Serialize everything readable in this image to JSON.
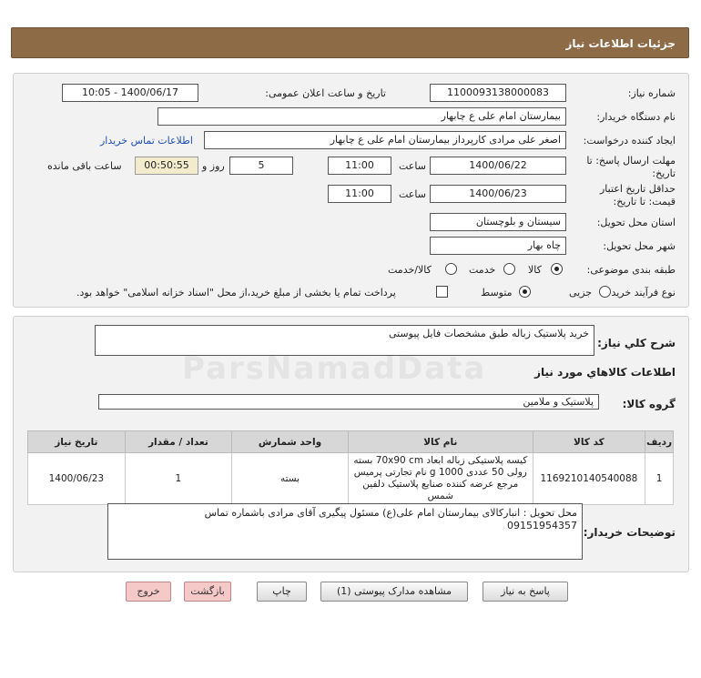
{
  "header": {
    "title": "جزئیات اطلاعات نیاز"
  },
  "form": {
    "need_number_label": "شماره نیاز:",
    "need_number": "1100093138000083",
    "announce_label": "تاریخ و ساعت اعلان عمومی:",
    "announce_value": "1400/06/17 - 10:05",
    "buyer_org_label": "نام دستگاه خریدار:",
    "buyer_org": "بیمارستان امام علی  ع  چابهار",
    "requester_label": "ایجاد کننده درخواست:",
    "requester": "اصغر علی مرادی کارپرداز بیمارستان امام علی  ع  چابهار",
    "buyer_contact_link": "اطلاعات تماس خریدار",
    "deadline_label": "مهلت ارسال پاسخ: تا",
    "deadline_label2": "تاریخ:",
    "deadline_date": "1400/06/22",
    "time_label": "ساعت",
    "deadline_time": "11:00",
    "days_value": "5",
    "days_label": "روز و",
    "remaining_time": "00:50:55",
    "remaining_label": "ساعت باقی مانده",
    "validity_label": "حداقل تاریخ اعتبار",
    "validity_label2": "قیمت: تا تاریخ:",
    "validity_date": "1400/06/23",
    "validity_time": "11:00",
    "province_label": "استان محل تحویل:",
    "province": "سیستان و بلوچستان",
    "city_label": "شهر محل تحویل:",
    "city": "چاه بهار",
    "category_label": "طبقه بندی موضوعی:",
    "category_options": [
      "کالا",
      "خدمت",
      "کالا/خدمت"
    ],
    "purchase_type_label": "نوع فرآیند خرید :",
    "purchase_options": [
      "جزیی",
      "متوسط"
    ],
    "payment_note": "پرداخت تمام یا بخشی از مبلغ خرید،از محل \"اسناد خزانه اسلامی\" خواهد بود."
  },
  "summary": {
    "need_desc_label": "شرح کلي نياز:",
    "need_desc": "خرید پلاستیک زباله طبق مشخصات فایل پیوستی",
    "goods_info_title": "اطلاعات کالاهاي مورد نياز",
    "goods_group_label": "گروه کالا:",
    "goods_group": "پلاستیک و ملامین",
    "watermark": "ParsNamadData"
  },
  "table": {
    "headers": [
      "ردیف",
      "کد کالا",
      "نام کالا",
      "واحد شمارش",
      "تعداد / مقدار",
      "تاریخ نیاز"
    ],
    "rows": [
      {
        "row": "1",
        "code": "1169210140540088",
        "name": "کیسه پلاستیکی زباله ابعاد 70x90 cm بسته رولی 50 عددی 1000 g نام تجارتی پرمیس مرجع عرضه کننده صنایع پلاستیک دلفین شمس",
        "unit": "بسته",
        "qty": "1",
        "date": "1400/06/23"
      }
    ]
  },
  "buyer_notes": {
    "label": "توضیحات خریدار:",
    "line1": "محل تحویل : انبارکالای بیمارستان امام علی(ع) مسئول پیگیری آقای مرادی باشماره تماس",
    "line2": "09151954357"
  },
  "buttons": {
    "reply": "پاسخ به نیاز",
    "view_docs": "مشاهده مدارک پیوستی (1)",
    "print": "چاپ",
    "back": "بازگشت",
    "exit": "خروج"
  }
}
